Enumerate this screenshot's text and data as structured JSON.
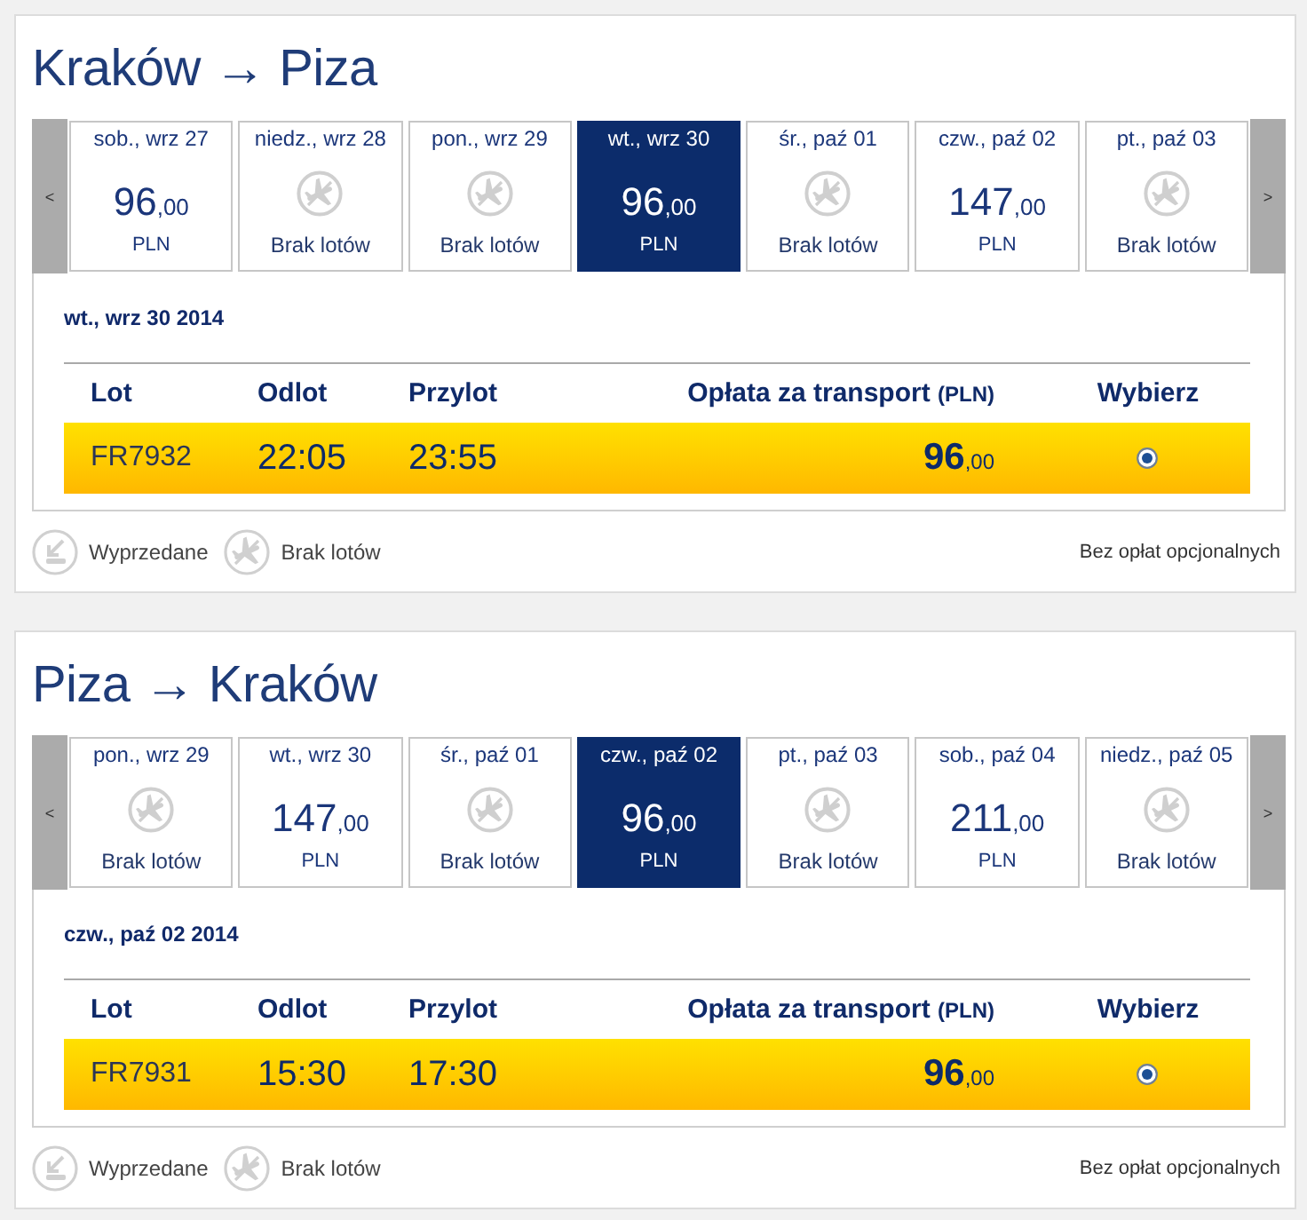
{
  "legs": [
    {
      "title": "Kraków → Piza",
      "nav": {
        "previous": "<",
        "next": ">"
      },
      "days": [
        {
          "date": "sob., wrz 27",
          "kind": "price",
          "amount": "96",
          "decimals": ",00",
          "currency": "PLN",
          "selected": false
        },
        {
          "date": "niedz., wrz 28",
          "kind": "no-flights",
          "label": "Brak lotów",
          "selected": false
        },
        {
          "date": "pon., wrz 29",
          "kind": "no-flights",
          "label": "Brak lotów",
          "selected": false
        },
        {
          "date": "wt., wrz 30",
          "kind": "price",
          "amount": "96",
          "decimals": ",00",
          "currency": "PLN",
          "selected": true
        },
        {
          "date": "śr., paź 01",
          "kind": "no-flights",
          "label": "Brak lotów",
          "selected": false
        },
        {
          "date": "czw., paź 02",
          "kind": "price",
          "amount": "147",
          "decimals": ",00",
          "currency": "PLN",
          "selected": false
        },
        {
          "date": "pt., paź 03",
          "kind": "no-flights",
          "label": "Brak lotów",
          "selected": false
        }
      ],
      "selected_date": "wt., wrz 30 2014",
      "table": {
        "columns": [
          {
            "label": "Lot"
          },
          {
            "label": "Odlot"
          },
          {
            "label": "Przylot"
          },
          {
            "label": "Opłata za transport",
            "unit": "(PLN)"
          },
          {
            "label": "Wybierz"
          }
        ],
        "rows": [
          {
            "flight": "FR7932",
            "departure": "22:05",
            "arrival": "23:55",
            "fare": "96",
            "fare_decimals": ",00",
            "selected": true
          }
        ]
      },
      "legend": [
        {
          "kind": "sold-out",
          "label": "Wyprzedane"
        },
        {
          "kind": "no-flights",
          "label": "Brak lotów"
        }
      ],
      "note": "Bez opłat opcjonalnych"
    },
    {
      "title": "Piza → Kraków",
      "nav": {
        "previous": "<",
        "next": ">"
      },
      "days": [
        {
          "date": "pon., wrz 29",
          "kind": "no-flights",
          "label": "Brak lotów",
          "selected": false
        },
        {
          "date": "wt., wrz 30",
          "kind": "price",
          "amount": "147",
          "decimals": ",00",
          "currency": "PLN",
          "selected": false
        },
        {
          "date": "śr., paź 01",
          "kind": "no-flights",
          "label": "Brak lotów",
          "selected": false
        },
        {
          "date": "czw., paź 02",
          "kind": "price",
          "amount": "96",
          "decimals": ",00",
          "currency": "PLN",
          "selected": true
        },
        {
          "date": "pt., paź 03",
          "kind": "no-flights",
          "label": "Brak lotów",
          "selected": false
        },
        {
          "date": "sob., paź 04",
          "kind": "price",
          "amount": "211",
          "decimals": ",00",
          "currency": "PLN",
          "selected": false
        },
        {
          "date": "niedz., paź 05",
          "kind": "no-flights",
          "label": "Brak lotów",
          "selected": false
        }
      ],
      "selected_date": "czw., paź 02 2014",
      "table": {
        "columns": [
          {
            "label": "Lot"
          },
          {
            "label": "Odlot"
          },
          {
            "label": "Przylot"
          },
          {
            "label": "Opłata za transport",
            "unit": "(PLN)"
          },
          {
            "label": "Wybierz"
          }
        ],
        "rows": [
          {
            "flight": "FR7931",
            "departure": "15:30",
            "arrival": "17:30",
            "fare": "96",
            "fare_decimals": ",00",
            "selected": true
          }
        ]
      },
      "legend": [
        {
          "kind": "sold-out",
          "label": "Wyprzedane"
        },
        {
          "kind": "no-flights",
          "label": "Brak lotów"
        }
      ],
      "note": "Bez opłat opcjonalnych"
    }
  ]
}
